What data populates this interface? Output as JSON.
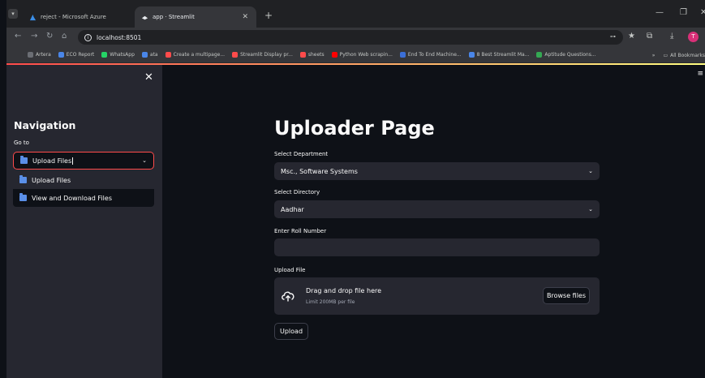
{
  "browser": {
    "tabs": [
      {
        "title": "reject - Microsoft Azure",
        "active": false
      },
      {
        "title": "app · Streamlit",
        "active": true
      }
    ],
    "new_tab_label": "+",
    "url": "localhost:8501",
    "bookmarks": [
      {
        "label": "Artera",
        "color": "#6b6e74"
      },
      {
        "label": "ECO Report",
        "color": "#4a86e8"
      },
      {
        "label": "WhatsApp",
        "color": "#25d366"
      },
      {
        "label": "ata",
        "color": "#4a86e8"
      },
      {
        "label": "Create a multipage...",
        "color": "#ff4b4b"
      },
      {
        "label": "Streamlit Display pr...",
        "color": "#ff4b4b"
      },
      {
        "label": "sheets",
        "color": "#ff4b4b"
      },
      {
        "label": "Python Web scrapin...",
        "color": "#ff0000"
      },
      {
        "label": "End To End Machine...",
        "color": "#3b6fd8"
      },
      {
        "label": "8 Best Streamlit Ma...",
        "color": "#4a86e8"
      },
      {
        "label": "Aptitude Questions...",
        "color": "#34a853"
      }
    ],
    "all_bookmarks_label": "All Bookmarks",
    "profile_initial": "T"
  },
  "sidebar": {
    "title": "Navigation",
    "goto_label": "Go to",
    "selected": "Upload Files",
    "options": [
      "Upload Files",
      "View and Download Files"
    ]
  },
  "main": {
    "title": "Uploader Page",
    "department_label": "Select Department",
    "department_value": "Msc., Software Systems",
    "directory_label": "Select Directory",
    "directory_value": "Aadhar",
    "roll_label": "Enter Roll Number",
    "roll_value": "",
    "upload_label": "Upload File",
    "drag_text": "Drag and drop file here",
    "limit_text": "Limit 200MB per file",
    "browse_label": "Browse files",
    "upload_button_label": "Upload"
  },
  "colors": {
    "accent": "#ff4b4b",
    "background": "#0e1117",
    "sidebar_bg": "#262730",
    "input_bg": "#262730",
    "text": "#fafafa"
  }
}
